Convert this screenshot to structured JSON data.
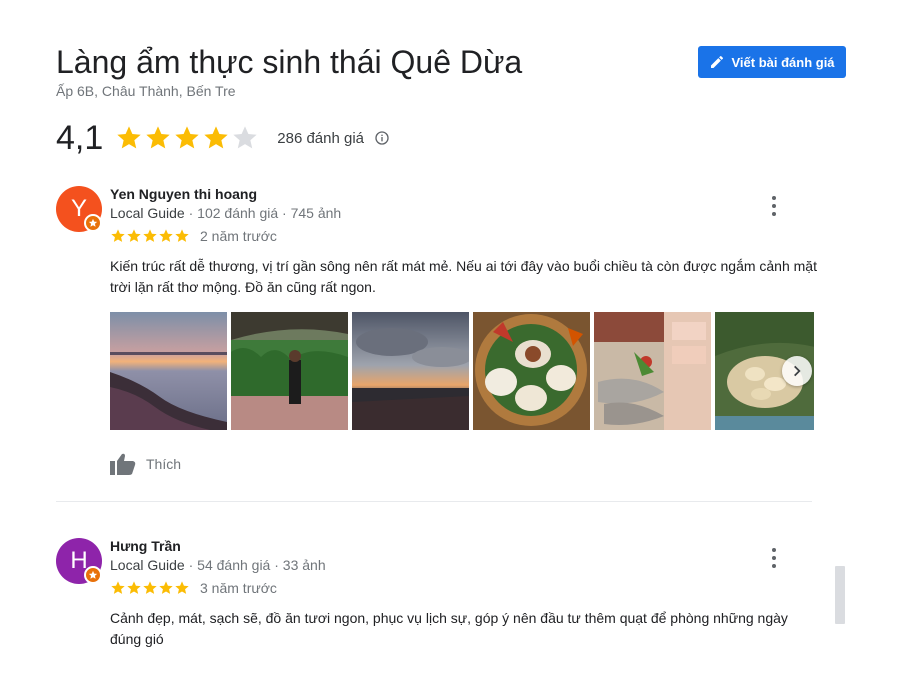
{
  "place": {
    "title": "Làng ẩm thực sinh thái Quê Dừa",
    "address": "Ấp 6B, Châu Thành, Bến Tre",
    "rating": "4,1",
    "stars_filled": 4,
    "stars_total": 5,
    "review_count": "286 đánh giá"
  },
  "actions": {
    "write_review_label": "Viết bài đánh giá"
  },
  "colors": {
    "accent": "#1a73e8",
    "star": "#fbbc04",
    "star_empty": "#dadce0",
    "avatar_1": "#f4511e",
    "avatar_2": "#8e24aa",
    "guide_badge": "#e8710a"
  },
  "reviews": [
    {
      "avatar_letter": "Y",
      "name": "Yen Nguyen thi hoang",
      "local_guide": "Local Guide",
      "stats": " · 102 đánh giá · 745 ảnh",
      "stars": 5,
      "date": "2 năm trước",
      "text": "Kiến trúc rất dễ thương, vị trí gần sông nên rất mát mẻ. Nếu ai tới đây vào buổi chiều tà còn được ngắm cảnh mặt trời lặn rất thơ mộng. Đồ ăn cũng rất ngon.",
      "photos": [
        "sunset-river-photo",
        "garden-woman-photo",
        "cloudy-sunset-photo",
        "food-platter-photo",
        "grilled-shrimp-photo",
        "snack-dish-photo"
      ],
      "like_label": "Thích"
    },
    {
      "avatar_letter": "H",
      "name": "Hưng Trần",
      "local_guide": "Local Guide",
      "stats": " · 54 đánh giá · 33 ảnh",
      "stars": 5,
      "date": "3 năm trước",
      "text": "Cảnh đẹp, mát, sạch sẽ, đồ ăn tươi ngon, phục vụ lịch sự, góp ý nên đầu tư thêm quạt để phòng những ngày đúng gió"
    }
  ]
}
